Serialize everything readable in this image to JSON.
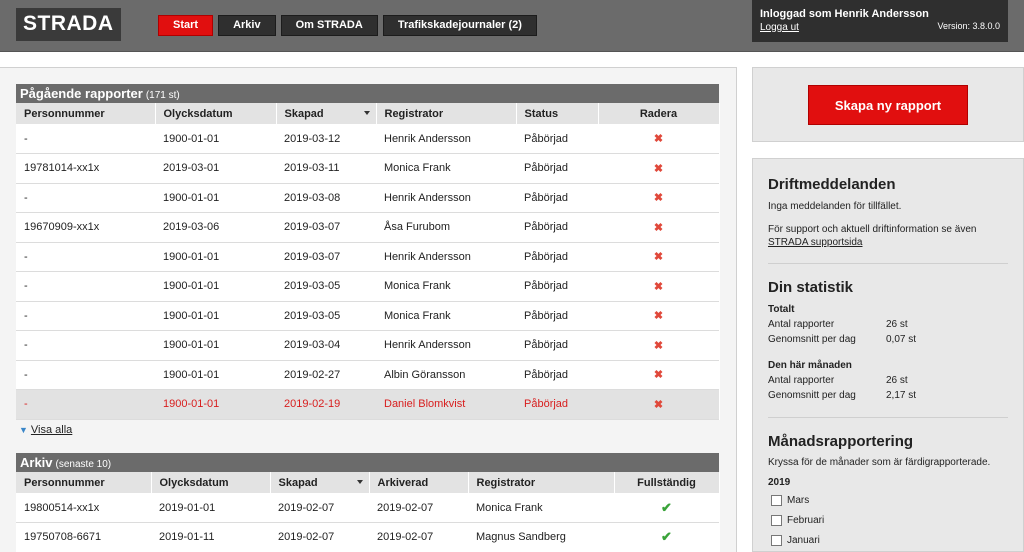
{
  "header": {
    "logo": "STRADA",
    "nav": [
      "Start",
      "Arkiv",
      "Om STRADA",
      "Trafikskadejournaler (2)"
    ],
    "user": "Inloggad som Henrik Andersson",
    "logout": "Logga ut",
    "version": "Version: 3.8.0.0"
  },
  "ongoing": {
    "title": "Pågående rapporter",
    "count": "(171 st)",
    "columns": [
      "Personnummer",
      "Olycksdatum",
      "Skapad",
      "Registrator",
      "Status",
      "Radera"
    ],
    "rows": [
      [
        "-",
        "1900-01-01",
        "2019-03-12",
        "Henrik Andersson",
        "Påbörjad"
      ],
      [
        "19781014-xx1x",
        "2019-03-01",
        "2019-03-11",
        "Monica Frank",
        "Påbörjad"
      ],
      [
        "-",
        "1900-01-01",
        "2019-03-08",
        "Henrik Andersson",
        "Påbörjad"
      ],
      [
        "19670909-xx1x",
        "2019-03-06",
        "2019-03-07",
        "Åsa Furubom",
        "Påbörjad"
      ],
      [
        "-",
        "1900-01-01",
        "2019-03-07",
        "Henrik Andersson",
        "Påbörjad"
      ],
      [
        "-",
        "1900-01-01",
        "2019-03-05",
        "Monica Frank",
        "Påbörjad"
      ],
      [
        "-",
        "1900-01-01",
        "2019-03-05",
        "Monica Frank",
        "Påbörjad"
      ],
      [
        "-",
        "1900-01-01",
        "2019-03-04",
        "Henrik Andersson",
        "Påbörjad"
      ],
      [
        "-",
        "1900-01-01",
        "2019-02-27",
        "Albin Göransson",
        "Påbörjad"
      ],
      [
        "-",
        "1900-01-01",
        "2019-02-19",
        "Daniel Blomkvist",
        "Påbörjad"
      ]
    ],
    "delete_icon": "x-icon",
    "show_all": "Visa alla"
  },
  "archive": {
    "title": "Arkiv",
    "count": "(senaste 10)",
    "columns": [
      "Personnummer",
      "Olycksdatum",
      "Skapad",
      "Arkiverad",
      "Registrator",
      "Fullständig"
    ],
    "rows": [
      [
        "19800514-xx1x",
        "2019-01-01",
        "2019-02-07",
        "2019-02-07",
        "Monica Frank"
      ],
      [
        "19750708-6671",
        "2019-01-11",
        "2019-02-07",
        "2019-02-07",
        "Magnus Sandberg"
      ]
    ],
    "complete_icon": "check-icon"
  },
  "sidebar": {
    "create_button": "Skapa ny rapport",
    "ops_title": "Driftmeddelanden",
    "ops_none": "Inga meddelanden för tillfället.",
    "ops_support": "För support och aktuell driftinformation se även",
    "ops_link": "STRADA supportsida",
    "stats_title": "Din statistik",
    "total_label": "Totalt",
    "month_label": "Den här månaden",
    "stat_reports": "Antal rapporter",
    "stat_avg": "Genomsnitt per dag",
    "total_reports": "26 st",
    "total_avg": "0,07 st",
    "month_reports": "26 st",
    "month_avg": "2,17 st",
    "monthly_title": "Månadsrapportering",
    "monthly_hint": "Kryssa för de månader som är färdigrapporterade.",
    "year": "2019",
    "months": [
      "Mars",
      "Februari",
      "Januari"
    ]
  },
  "colors": {
    "accent": "#e10f0f",
    "header": "#6b6b6b",
    "dark": "#2f2f2f",
    "check": "#39a339"
  }
}
